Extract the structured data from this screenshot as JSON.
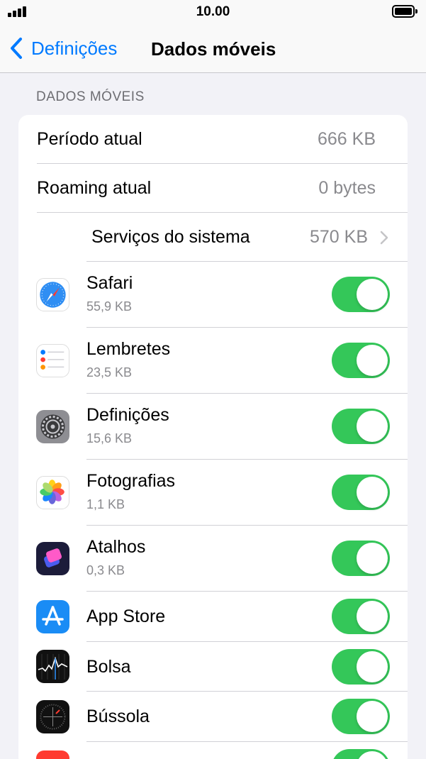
{
  "status_bar": {
    "time": "10.00"
  },
  "nav": {
    "back_label": "Definições",
    "title": "Dados móveis"
  },
  "section": {
    "header": "DADOS MÓVEIS"
  },
  "summary": {
    "current_period_label": "Período atual",
    "current_period_value": "666 KB",
    "roaming_label": "Roaming atual",
    "roaming_value": "0 bytes",
    "system_services_label": "Serviços do sistema",
    "system_services_value": "570 KB"
  },
  "apps": [
    {
      "name": "Safari",
      "size": "55,9 KB",
      "icon": "safari-icon",
      "enabled": true
    },
    {
      "name": "Lembretes",
      "size": "23,5 KB",
      "icon": "reminders-icon",
      "enabled": true
    },
    {
      "name": "Definições",
      "size": "15,6 KB",
      "icon": "settings-icon",
      "enabled": true
    },
    {
      "name": "Fotografias",
      "size": "1,1 KB",
      "icon": "photos-icon",
      "enabled": true
    },
    {
      "name": "Atalhos",
      "size": "0,3 KB",
      "icon": "shortcuts-icon",
      "enabled": true
    },
    {
      "name": "App Store",
      "size": "",
      "icon": "app-store-icon",
      "enabled": true
    },
    {
      "name": "Bolsa",
      "size": "",
      "icon": "stocks-icon",
      "enabled": true
    },
    {
      "name": "Bússola",
      "size": "",
      "icon": "compass-icon",
      "enabled": true
    },
    {
      "name": "",
      "size": "",
      "icon": "red-app-icon",
      "enabled": true
    }
  ],
  "colors": {
    "accent": "#007aff",
    "toggle_on": "#34c759",
    "background": "#f2f2f7"
  }
}
